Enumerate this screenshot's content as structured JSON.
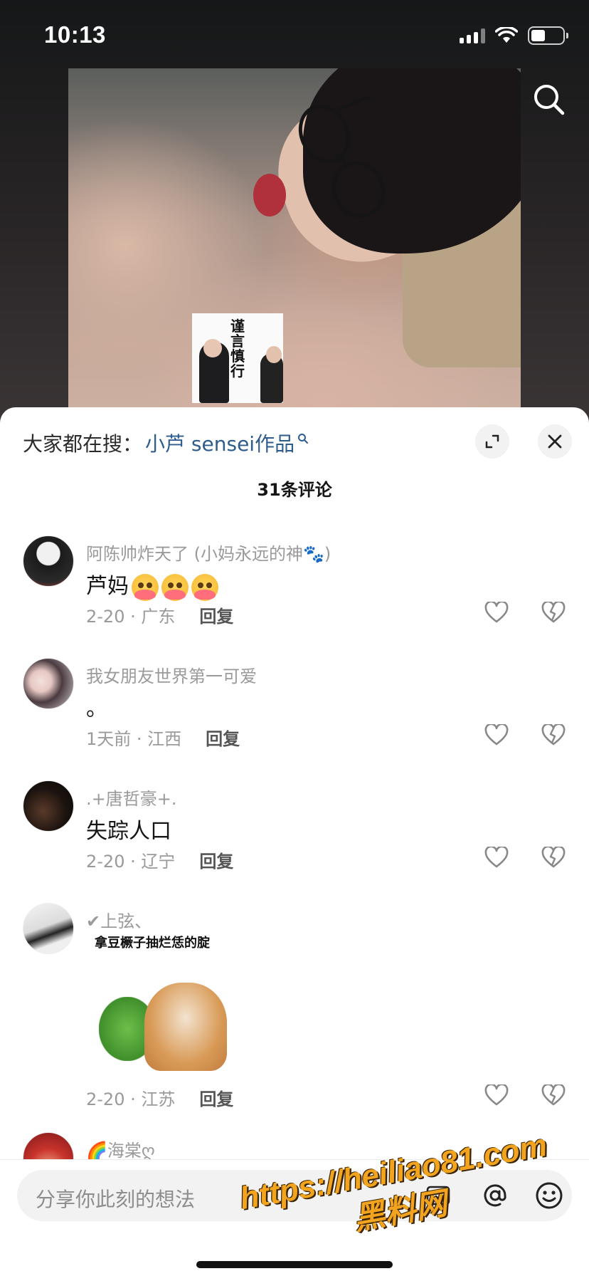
{
  "status_bar": {
    "time": "10:13"
  },
  "icons": {
    "search": "search-icon",
    "expand": "expand-icon",
    "close": "close-icon",
    "like": "heart-icon",
    "dislike": "broken-heart-icon",
    "at": "at-icon",
    "emoji": "smiley-icon"
  },
  "post": {
    "sticker_text": "谨言慎行"
  },
  "comments_panel": {
    "suggest_prefix": "大家都在搜：",
    "suggest_link": "小芦 sensei作品",
    "count_label": "31条评论",
    "comments": [
      {
        "name": "阿陈帅炸天了 (小妈永远的神🐾)",
        "text": "芦妈",
        "emojis": 3,
        "date": "2-20 · 广东",
        "reply": "回复"
      },
      {
        "name": "我女朋友世界第一可爱",
        "text": "。",
        "date": "1天前 · 江西",
        "reply": "回复"
      },
      {
        "name": ".+唐哲豪+.",
        "text": "失踪人口",
        "date": "2-20 · 辽宁",
        "reply": "回复"
      },
      {
        "name": "✔上弦、",
        "sticker_caption": "拿豆橛子抽烂恁的腚",
        "date": "2-20 · 江苏",
        "reply": "回复"
      },
      {
        "name": "🌈海棠ღ"
      }
    ]
  },
  "input": {
    "placeholder": "分享你此刻的想法"
  },
  "watermark": {
    "line1": "https://heiliao81.com",
    "line2": "黑料网"
  },
  "colors": {
    "link": "#2e5c8c",
    "sheet_bg": "#ffffff",
    "muted": "#9a9a9a"
  }
}
